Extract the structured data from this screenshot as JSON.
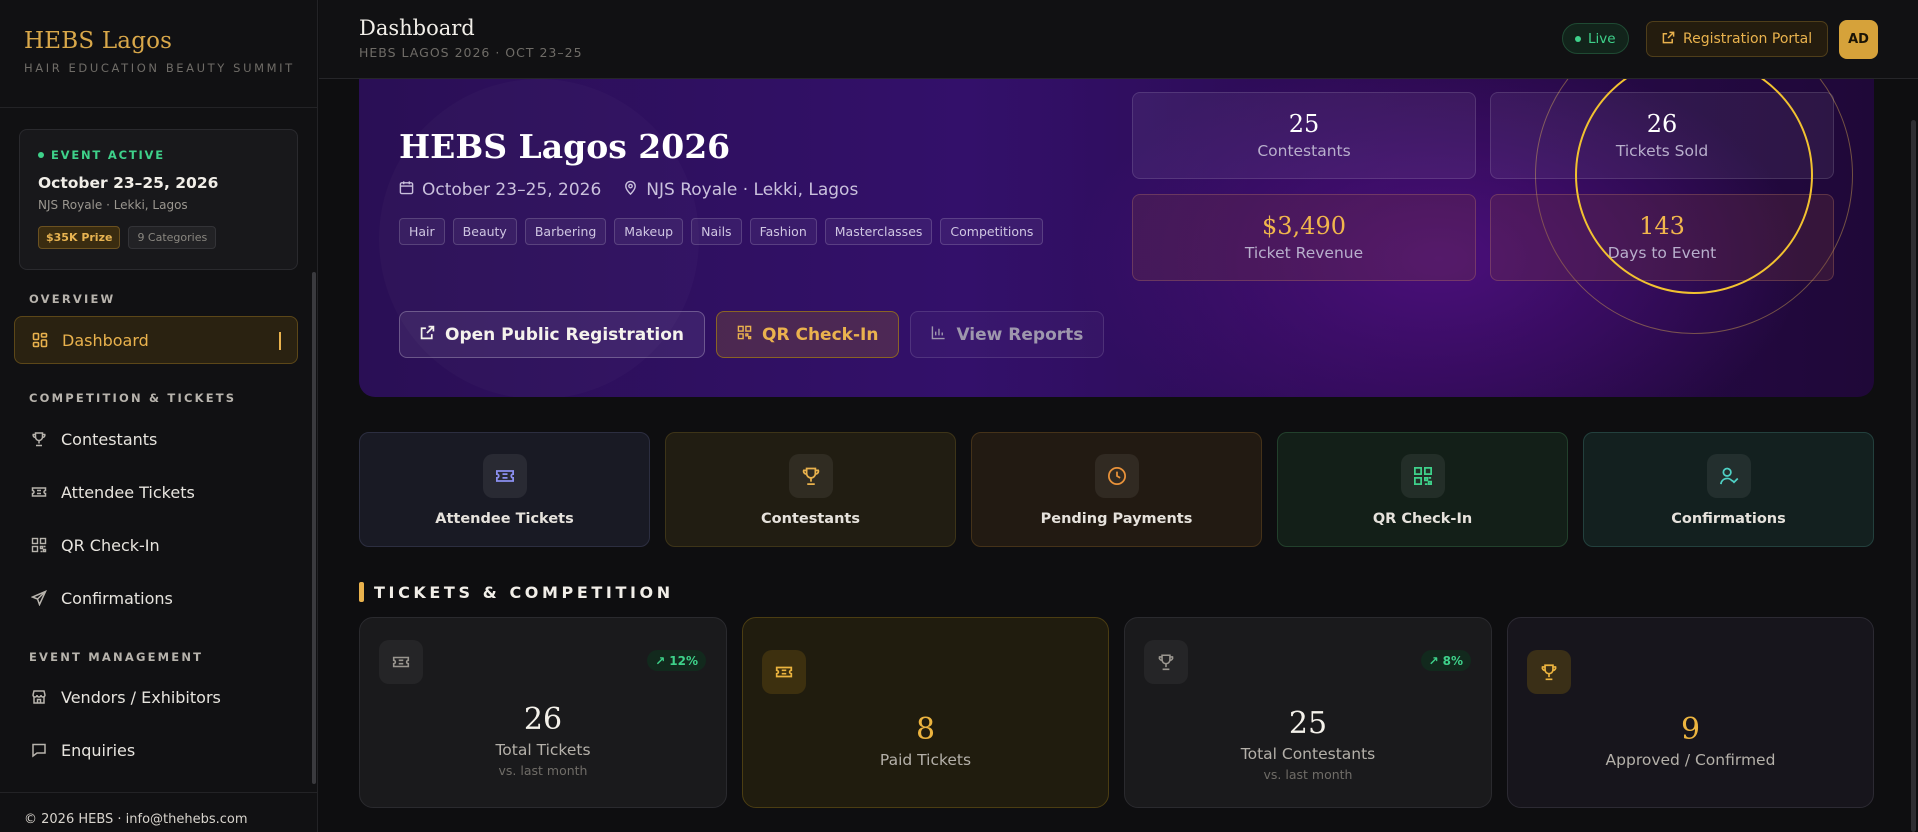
{
  "brand": {
    "title": "HEBS Lagos",
    "subtitle": "HAIR EDUCATION BEAUTY SUMMIT"
  },
  "event_card": {
    "status": "EVENT ACTIVE",
    "dates": "October 23–25, 2026",
    "venue": "NJS Royale · Lekki, Lagos",
    "prize_badge": "$35K Prize",
    "categories_badge": "9 Categories"
  },
  "sidebar": {
    "sections": [
      {
        "label": "OVERVIEW",
        "items": [
          {
            "label": "Dashboard",
            "icon": "grid-icon",
            "active": true
          }
        ]
      },
      {
        "label": "COMPETITION & TICKETS",
        "items": [
          {
            "label": "Contestants",
            "icon": "trophy-icon"
          },
          {
            "label": "Attendee Tickets",
            "icon": "ticket-icon"
          },
          {
            "label": "QR Check-In",
            "icon": "qr-icon"
          },
          {
            "label": "Confirmations",
            "icon": "send-icon"
          }
        ]
      },
      {
        "label": "EVENT MANAGEMENT",
        "items": [
          {
            "label": "Vendors / Exhibitors",
            "icon": "store-icon"
          },
          {
            "label": "Enquiries",
            "icon": "chat-icon"
          }
        ]
      }
    ],
    "footer": "© 2026 HEBS · info@thehebs.com"
  },
  "topbar": {
    "title": "Dashboard",
    "subtitle": "HEBS LAGOS 2026 · OCT 23–25",
    "live_label": "Live",
    "portal_label": "Registration Portal",
    "avatar_initials": "AD"
  },
  "hero": {
    "title": "HEBS Lagos 2026",
    "dates": "October 23–25, 2026",
    "venue": "NJS Royale · Lekki, Lagos",
    "tags": [
      "Hair",
      "Beauty",
      "Barbering",
      "Makeup",
      "Nails",
      "Fashion",
      "Masterclasses",
      "Competitions"
    ],
    "buttons": {
      "registration": "Open Public Registration",
      "checkin": "QR Check-In",
      "reports": "View Reports"
    },
    "stats": [
      {
        "value": "25",
        "label": "Contestants"
      },
      {
        "value": "26",
        "label": "Tickets Sold"
      },
      {
        "value": "$3,490",
        "label": "Ticket Revenue"
      },
      {
        "value": "143",
        "label": "Days to Event"
      }
    ]
  },
  "quick_actions": [
    {
      "label": "Attendee Tickets",
      "icon": "ticket-icon",
      "color": "#8b8ff0"
    },
    {
      "label": "Contestants",
      "icon": "trophy-icon",
      "color": "#e9b24d"
    },
    {
      "label": "Pending Payments",
      "icon": "clock-icon",
      "color": "#e9923a"
    },
    {
      "label": "QR Check-In",
      "icon": "qr-icon",
      "color": "#3ed18a"
    },
    {
      "label": "Confirmations",
      "icon": "user-check-icon",
      "color": "#4fd1c5"
    }
  ],
  "tickets_section": {
    "heading": "TICKETS & COMPETITION",
    "kpis": [
      {
        "value": "26",
        "label": "Total Tickets",
        "sub": "vs. last month",
        "trend": "12%"
      },
      {
        "value": "8",
        "label": "Paid Tickets"
      },
      {
        "value": "25",
        "label": "Total Contestants",
        "sub": "vs. last month",
        "trend": "8%"
      },
      {
        "value": "9",
        "label": "Approved / Confirmed"
      }
    ]
  }
}
